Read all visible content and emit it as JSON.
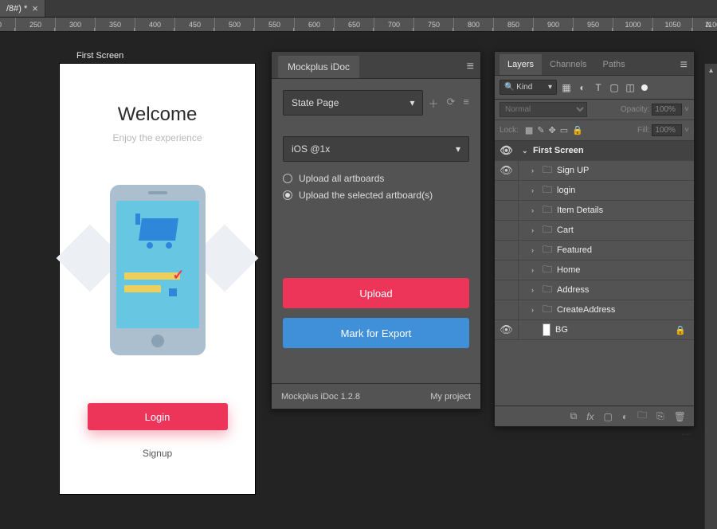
{
  "tab": {
    "title": "/8#) *"
  },
  "ruler": {
    "start": 200,
    "end": 1450,
    "step": 50
  },
  "artboard": {
    "label": "First Screen",
    "title": "Welcome",
    "subtitle": "Enjoy the experience",
    "login": "Login",
    "signup": "Signup"
  },
  "mockplus": {
    "tab": "Mockplus iDoc",
    "statePage": "State Page",
    "platform": "iOS @1x",
    "radio_all": "Upload all artboards",
    "radio_sel": "Upload the selected artboard(s)",
    "upload": "Upload",
    "mark": "Mark for Export",
    "version": "Mockplus iDoc 1.2.8",
    "project": "My project"
  },
  "layers": {
    "tabs": [
      "Layers",
      "Channels",
      "Paths"
    ],
    "kind": "Kind",
    "blend": "Normal",
    "opacityLabel": "Opacity:",
    "opacity": "100%",
    "lockLabel": "Lock:",
    "fillLabel": "Fill:",
    "fill": "100%",
    "root": "First Screen",
    "items": [
      {
        "name": "Sign UP",
        "visible": true
      },
      {
        "name": "login",
        "visible": false
      },
      {
        "name": "Item Details",
        "visible": false
      },
      {
        "name": "Cart",
        "visible": false
      },
      {
        "name": "Featured",
        "visible": false
      },
      {
        "name": "Home",
        "visible": false
      },
      {
        "name": "Address",
        "visible": false
      },
      {
        "name": "CreateAddress",
        "visible": false
      }
    ],
    "bg": "BG"
  },
  "chart_data": null
}
